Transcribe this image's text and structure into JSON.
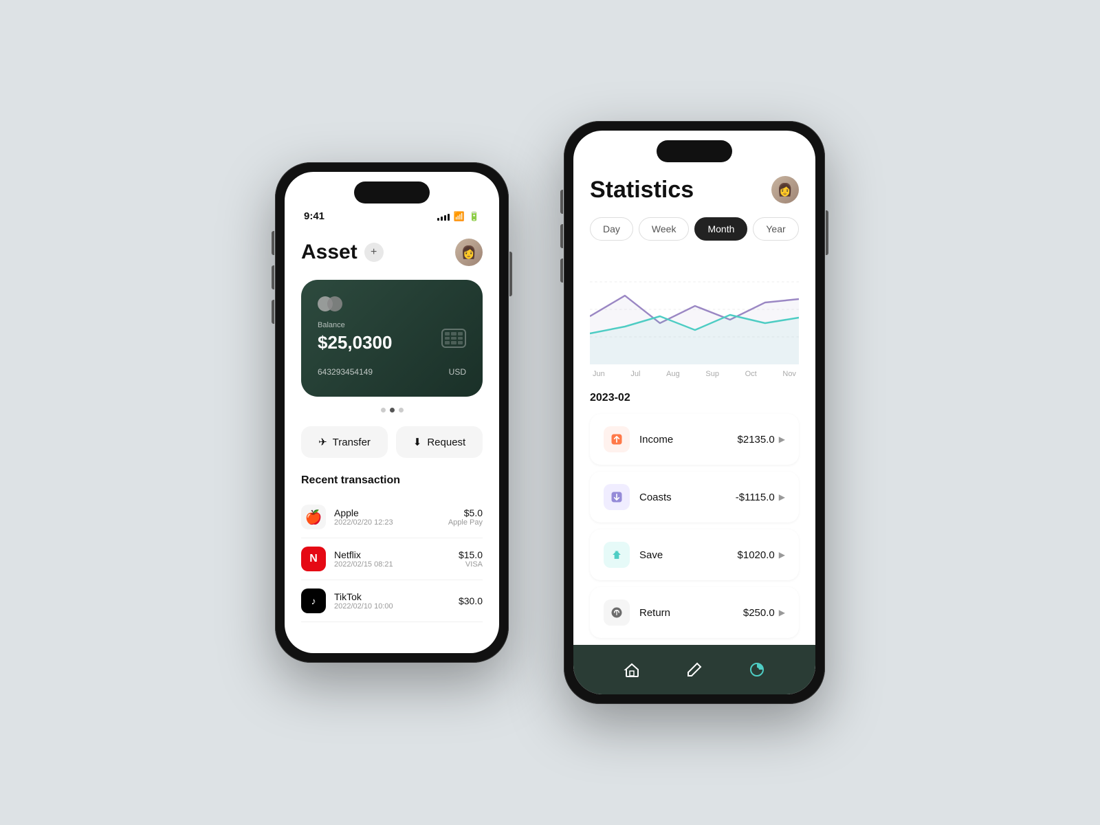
{
  "phone1": {
    "statusBar": {
      "time": "9:41",
      "signalBars": [
        4,
        6,
        8,
        10,
        12
      ],
      "wifi": "wifi",
      "battery": "battery"
    },
    "header": {
      "title": "Asset",
      "addLabel": "+",
      "avatarEmoji": "👩"
    },
    "card": {
      "logoLeft": "",
      "logoRight": "",
      "balanceLabel": "Balance",
      "balance": "$25,0300",
      "cardNumber": "643293454149",
      "currency": "USD"
    },
    "cardDots": [
      "inactive",
      "active",
      "inactive"
    ],
    "actions": [
      {
        "id": "transfer",
        "icon": "✈",
        "label": "Transfer"
      },
      {
        "id": "request",
        "icon": "⬇",
        "label": "Request"
      }
    ],
    "recentTitle": "Recent transaction",
    "transactions": [
      {
        "id": "apple",
        "icon": "🍎",
        "iconBg": "#f5f5f5",
        "name": "Apple",
        "date": "2022/02/20 12:23",
        "amount": "$5.0",
        "method": "Apple Pay"
      },
      {
        "id": "netflix",
        "icon": "N",
        "iconBg": "#e50914",
        "iconColor": "#fff",
        "name": "Netflix",
        "date": "2022/02/15 08:21",
        "amount": "$15.0",
        "method": "VISA"
      },
      {
        "id": "tiktok",
        "icon": "♪",
        "iconBg": "#010101",
        "iconColor": "#fff",
        "name": "TikTok",
        "date": "2022/02/10 10:00",
        "amount": "$30.0",
        "method": ""
      }
    ]
  },
  "phone2": {
    "header": {
      "title": "Statistics",
      "avatarEmoji": "👩"
    },
    "periods": [
      {
        "id": "day",
        "label": "Day",
        "active": false
      },
      {
        "id": "week",
        "label": "Week",
        "active": false
      },
      {
        "id": "month",
        "label": "Month",
        "active": true
      },
      {
        "id": "year",
        "label": "Year",
        "active": false
      }
    ],
    "chart": {
      "labels": [
        "Jun",
        "Jul",
        "Aug",
        "Sup",
        "Oct",
        "Nov"
      ],
      "purpleData": [
        60,
        85,
        50,
        70,
        55,
        75,
        80
      ],
      "tealData": [
        35,
        45,
        60,
        40,
        65,
        50,
        70
      ],
      "colors": {
        "purple": "#9b87c4",
        "teal": "#4ecdc4"
      }
    },
    "dateLabel": "2023-02",
    "statsItems": [
      {
        "id": "income",
        "icon": "📥",
        "iconBg": "#fff2ee",
        "label": "Income",
        "value": "$2135.0"
      },
      {
        "id": "coasts",
        "icon": "📤",
        "iconBg": "#f0edff",
        "label": "Coasts",
        "value": "-$1115.0"
      },
      {
        "id": "save",
        "icon": "🔽",
        "iconBg": "#e6faf8",
        "label": "Save",
        "value": "$1020.0"
      },
      {
        "id": "return",
        "icon": "🔄",
        "iconBg": "#f5f5f5",
        "label": "Return",
        "value": "$250.0"
      }
    ],
    "nav": [
      {
        "id": "home",
        "icon": "⌂",
        "active": false
      },
      {
        "id": "edit",
        "icon": "✏",
        "active": false
      },
      {
        "id": "stats",
        "icon": "◕",
        "active": true
      }
    ]
  },
  "colors": {
    "accent": "#2a3c35",
    "teal": "#4ecdc4",
    "purple": "#9b87c4"
  }
}
